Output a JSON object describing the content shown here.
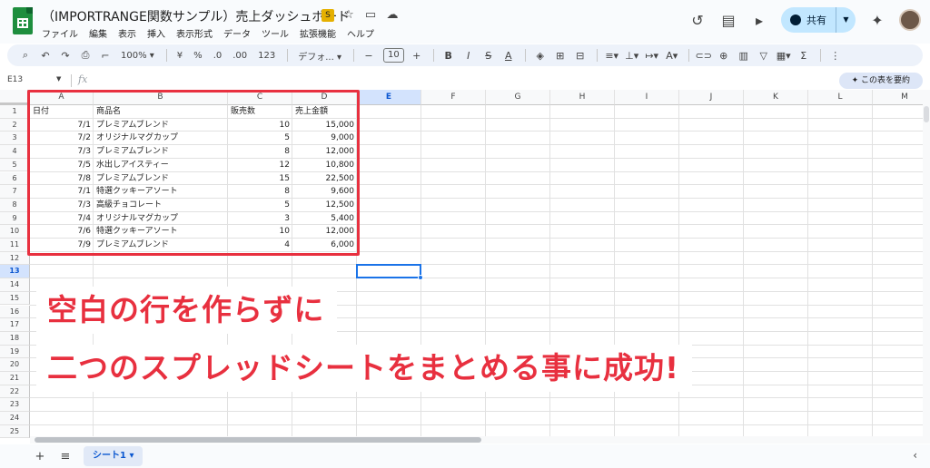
{
  "app": {
    "title": "（IMPORTRANGE関数サンプル）売上ダッシュボード",
    "badge_text": "S",
    "menu": [
      "ファイル",
      "編集",
      "表示",
      "挿入",
      "表示形式",
      "データ",
      "ツール",
      "拡張機能",
      "ヘルプ"
    ],
    "share_label": "共有"
  },
  "toolbar": {
    "zoom": "100%",
    "currency": "¥",
    "percent": "%",
    "decimal_decrease": ".0",
    "decimal_increase": ".00",
    "number_format": "123",
    "font": "デフォ...",
    "font_size": "10",
    "bold": "B",
    "italic": "I",
    "strike": "S",
    "text_color": "A",
    "sigma": "Σ"
  },
  "formula_bar": {
    "name_box": "E13",
    "fx": "fx",
    "summarize_label": "この表を要約"
  },
  "grid": {
    "columns": [
      "A",
      "B",
      "C",
      "D",
      "E",
      "F",
      "G",
      "H",
      "I",
      "J",
      "K",
      "L",
      "M"
    ],
    "rows": [
      "1",
      "2",
      "3",
      "4",
      "5",
      "6",
      "7",
      "8",
      "9",
      "10",
      "11",
      "12",
      "13",
      "14",
      "15",
      "16",
      "17",
      "18",
      "19",
      "20",
      "21",
      "22",
      "23",
      "24",
      "25"
    ],
    "selected_cell": "E13",
    "header": [
      "日付",
      "商品名",
      "販売数",
      "売上金額"
    ],
    "data": [
      [
        "7/1",
        "プレミアムブレンド",
        "10",
        "15,000"
      ],
      [
        "7/2",
        "オリジナルマグカップ",
        "5",
        "9,000"
      ],
      [
        "7/3",
        "プレミアムブレンド",
        "8",
        "12,000"
      ],
      [
        "7/5",
        "水出しアイスティー",
        "12",
        "10,800"
      ],
      [
        "7/8",
        "プレミアムブレンド",
        "15",
        "22,500"
      ],
      [
        "7/1",
        "特選クッキーアソート",
        "8",
        "9,600"
      ],
      [
        "7/3",
        "高級チョコレート",
        "5",
        "12,500"
      ],
      [
        "7/4",
        "オリジナルマグカップ",
        "3",
        "5,400"
      ],
      [
        "7/6",
        "特選クッキーアソート",
        "10",
        "12,000"
      ],
      [
        "7/9",
        "プレミアムブレンド",
        "4",
        "6,000"
      ]
    ]
  },
  "annotation": {
    "line1": "空白の行を作らずに",
    "line2": "二つのスプレッドシートをまとめる事に成功!"
  },
  "bottom": {
    "sheet_tab": "シート1"
  },
  "colors": {
    "highlight_red": "#e8303f",
    "selection_blue": "#1a73e8",
    "share_bg": "#c2e7ff",
    "sheets_green": "#1e8e3e"
  }
}
